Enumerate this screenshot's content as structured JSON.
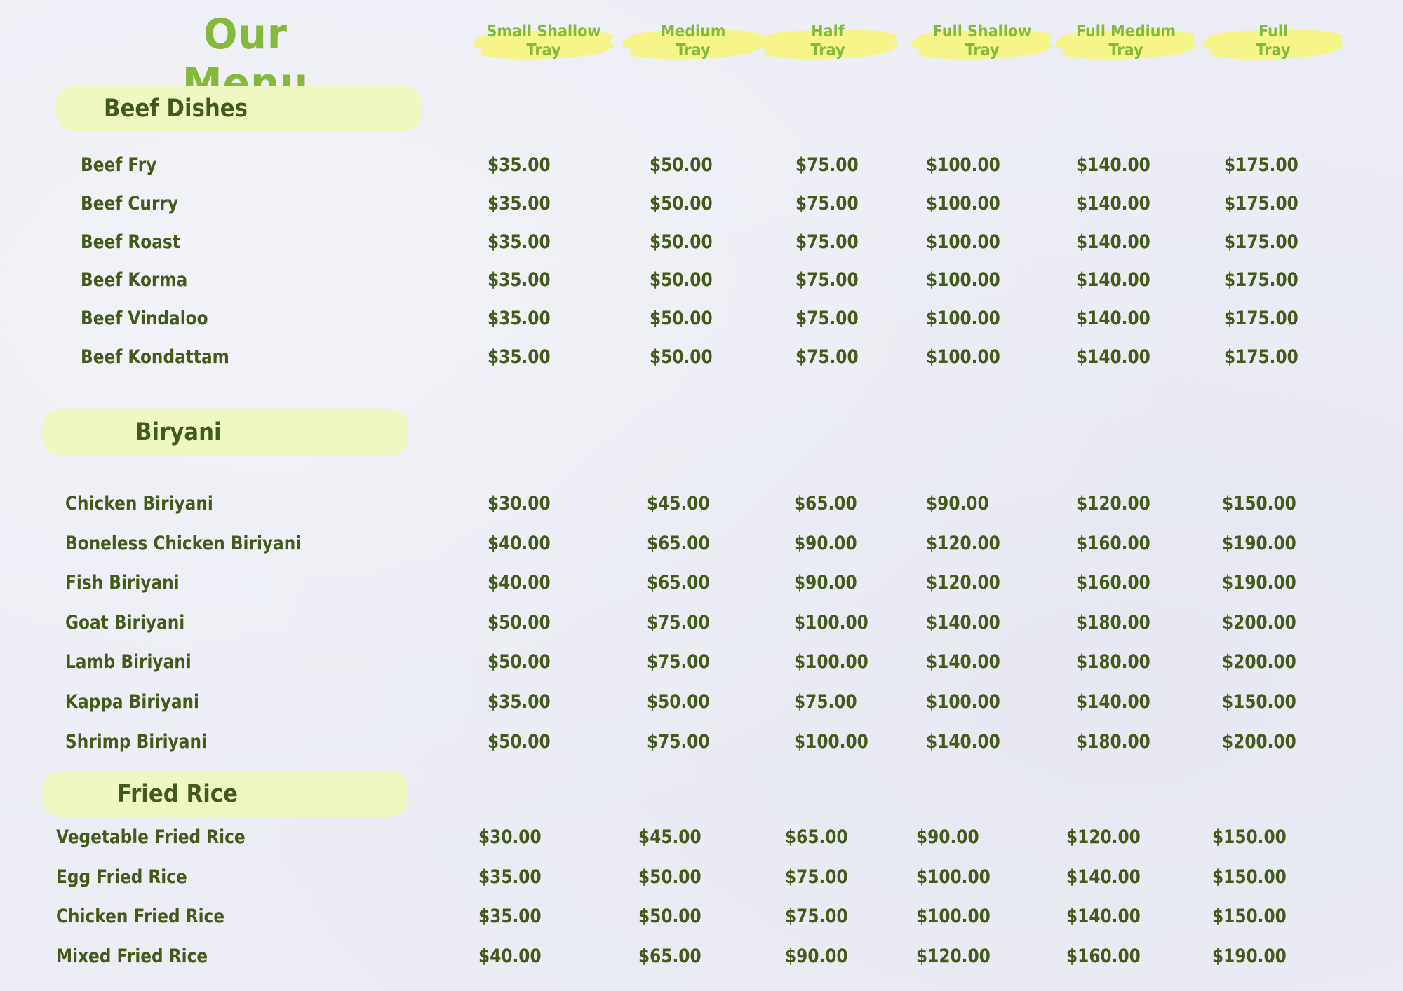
{
  "title": "Our Menu",
  "colors": {
    "background": "#ecedf5",
    "title_green": "#86b83a",
    "text_dark_green": "#445a1a",
    "pill_fill": "#eef8c0",
    "brush_yellow": "#f5f58a"
  },
  "columns": [
    {
      "label": "Small Shallow\nTray"
    },
    {
      "label": "Medium\nTray"
    },
    {
      "label": "Half\nTray"
    },
    {
      "label": "Full Shallow\nTray"
    },
    {
      "label": "Full Medium\nTray"
    },
    {
      "label": "Full\nTray"
    }
  ],
  "sections": [
    {
      "name": "Beef Dishes",
      "items": [
        {
          "name": "Beef Fry",
          "prices": [
            "$35.00",
            "$50.00",
            "$75.00",
            "$100.00",
            "$140.00",
            "$175.00"
          ]
        },
        {
          "name": "Beef Curry",
          "prices": [
            "$35.00",
            "$50.00",
            "$75.00",
            "$100.00",
            "$140.00",
            "$175.00"
          ]
        },
        {
          "name": "Beef Roast",
          "prices": [
            "$35.00",
            "$50.00",
            "$75.00",
            "$100.00",
            "$140.00",
            "$175.00"
          ]
        },
        {
          "name": "Beef Korma",
          "prices": [
            "$35.00",
            "$50.00",
            "$75.00",
            "$100.00",
            "$140.00",
            "$175.00"
          ]
        },
        {
          "name": "Beef Vindaloo",
          "prices": [
            "$35.00",
            "$50.00",
            "$75.00",
            "$100.00",
            "$140.00",
            "$175.00"
          ]
        },
        {
          "name": "Beef Kondattam",
          "prices": [
            "$35.00",
            "$50.00",
            "$75.00",
            "$100.00",
            "$140.00",
            "$175.00"
          ]
        }
      ]
    },
    {
      "name": "Biryani",
      "items": [
        {
          "name": "Chicken Biriyani",
          "prices": [
            "$30.00",
            "$45.00",
            "$65.00",
            "$90.00",
            "$120.00",
            "$150.00"
          ]
        },
        {
          "name": "Boneless Chicken Biriyani",
          "prices": [
            "$40.00",
            "$65.00",
            "$90.00",
            "$120.00",
            "$160.00",
            "$190.00"
          ]
        },
        {
          "name": "Fish Biriyani",
          "prices": [
            "$40.00",
            "$65.00",
            "$90.00",
            "$120.00",
            "$160.00",
            "$190.00"
          ]
        },
        {
          "name": "Goat Biriyani",
          "prices": [
            "$50.00",
            "$75.00",
            "$100.00",
            "$140.00",
            "$180.00",
            "$200.00"
          ]
        },
        {
          "name": "Lamb Biriyani",
          "prices": [
            "$50.00",
            "$75.00",
            "$100.00",
            "$140.00",
            "$180.00",
            "$200.00"
          ]
        },
        {
          "name": "Kappa Biriyani",
          "prices": [
            "$35.00",
            "$50.00",
            "$75.00",
            "$100.00",
            "$140.00",
            "$150.00"
          ]
        },
        {
          "name": "Shrimp Biriyani",
          "prices": [
            "$50.00",
            "$75.00",
            "$100.00",
            "$140.00",
            "$180.00",
            "$200.00"
          ]
        }
      ]
    },
    {
      "name": "Fried Rice",
      "items": [
        {
          "name": "Vegetable Fried Rice",
          "prices": [
            "$30.00",
            "$45.00",
            "$65.00",
            "$90.00",
            "$120.00",
            "$150.00"
          ]
        },
        {
          "name": "Egg Fried Rice",
          "prices": [
            "$35.00",
            "$50.00",
            "$75.00",
            "$100.00",
            "$140.00",
            "$150.00"
          ]
        },
        {
          "name": "Chicken Fried Rice",
          "prices": [
            "$35.00",
            "$50.00",
            "$75.00",
            "$100.00",
            "$140.00",
            "$150.00"
          ]
        },
        {
          "name": "Mixed Fried Rice",
          "prices": [
            "$40.00",
            "$65.00",
            "$90.00",
            "$120.00",
            "$160.00",
            "$190.00"
          ]
        }
      ]
    }
  ]
}
